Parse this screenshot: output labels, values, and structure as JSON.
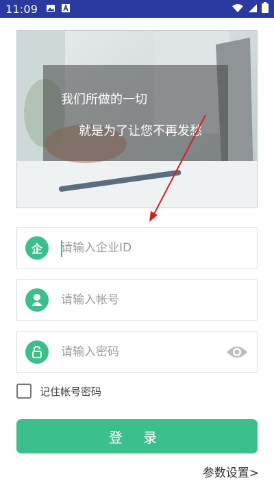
{
  "status_bar": {
    "time": "11:09",
    "icons_left": [
      "image-icon",
      "a-icon"
    ],
    "icons_right": [
      "wifi-icon",
      "signal-icon",
      "battery-icon"
    ],
    "background": "#2b3a9e"
  },
  "banner": {
    "line1": "我们所做的一切",
    "line2": "就是为了让您不再发愁"
  },
  "login_form": {
    "enterprise_id": {
      "placeholder": "请输入企业ID",
      "icon_text": "企",
      "icon": "enterprise-icon"
    },
    "account": {
      "placeholder": "请输入帐号",
      "icon": "user-icon"
    },
    "password": {
      "placeholder": "请输入密码",
      "icon": "lock-icon",
      "toggle_icon": "eye-icon"
    },
    "remember_label": "记住帐号密码",
    "login_button": "登 录",
    "settings_link": "参数设置>"
  },
  "colors": {
    "accent": "#3cbf8d",
    "status_bar": "#2b3a9e"
  }
}
